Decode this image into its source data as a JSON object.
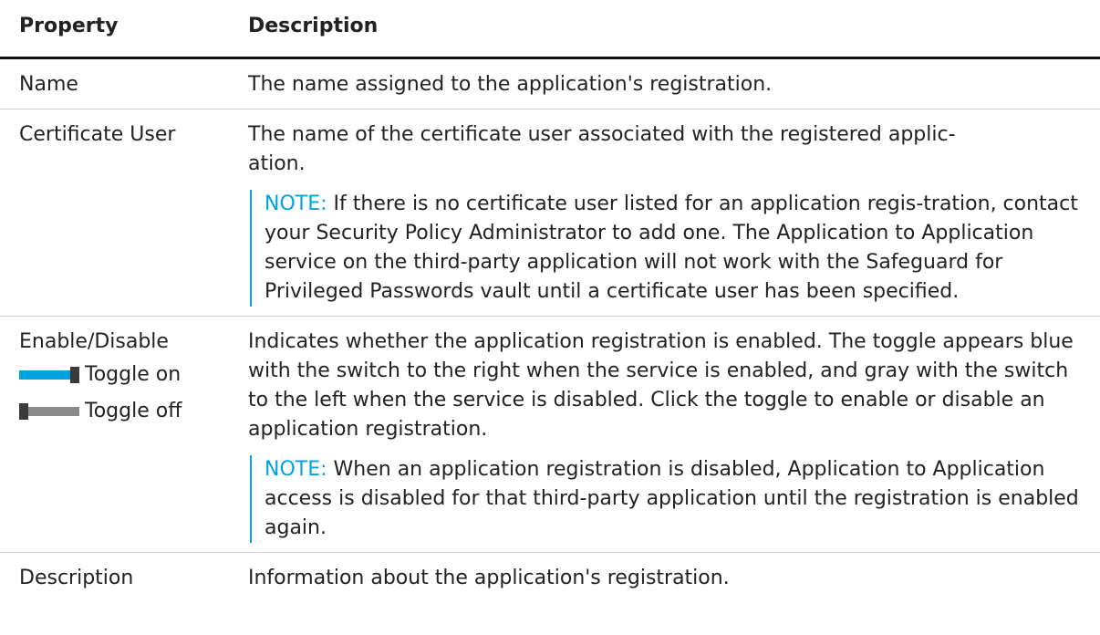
{
  "table": {
    "headers": {
      "property": "Property",
      "description": "Description"
    },
    "rows": [
      {
        "property": "Name",
        "description": "The name assigned to the application's registration."
      },
      {
        "property": "Certificate User",
        "description": "The name of the certificate user associated with the registered applic-ation.",
        "note_label": "NOTE:",
        "note_text": " If there is no certificate user listed for an application regis-tration, contact your Security Policy Administrator to add one. The Application to Application service on the third-party application will not work with the Safeguard for Privileged Passwords vault until a certificate user has been specified."
      },
      {
        "property": "Enable/Disable",
        "toggle_on_label": "Toggle on",
        "toggle_off_label": "Toggle off",
        "description": "Indicates whether the application registration is enabled. The toggle appears blue with the switch to the right when the service is enabled, and gray with the switch to the left when the service is disabled. Click the toggle to enable or disable an application registration.",
        "note_label": "NOTE:",
        "note_text": " When an application registration is disabled, Application to Application access is disabled for that third-party application until the registration is enabled again."
      },
      {
        "property": "Description",
        "description": "Information about the application's registration."
      }
    ]
  },
  "colors": {
    "note_accent": "#00a3e0",
    "toggle_on": "#00a3e0",
    "toggle_off": "#8a8a8a",
    "toggle_knob": "#3a3a3a"
  },
  "icons": {
    "toggle_on": "toggle-on-icon",
    "toggle_off": "toggle-off-icon"
  }
}
